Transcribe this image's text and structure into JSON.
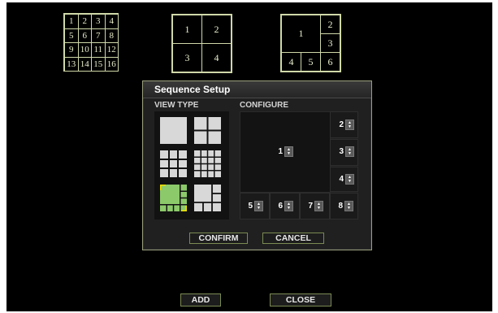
{
  "layouts": {
    "sixteen": [
      "1",
      "2",
      "3",
      "4",
      "5",
      "6",
      "7",
      "8",
      "9",
      "10",
      "11",
      "12",
      "13",
      "14",
      "15",
      "16"
    ],
    "four": [
      "1",
      "2",
      "3",
      "4"
    ],
    "six": [
      "1",
      "2",
      "3",
      "4",
      "5",
      "6"
    ]
  },
  "dialog": {
    "title": "Sequence Setup",
    "view_type_label": "VIEW TYPE",
    "configure_label": "CONFIGURE",
    "selected_view_type": "1+7 split",
    "channels": [
      {
        "slot": "1",
        "value": "1"
      },
      {
        "slot": "2",
        "value": "2"
      },
      {
        "slot": "3",
        "value": "3"
      },
      {
        "slot": "4",
        "value": "4"
      },
      {
        "slot": "5",
        "value": "5"
      },
      {
        "slot": "6",
        "value": "6"
      },
      {
        "slot": "7",
        "value": "7"
      },
      {
        "slot": "8",
        "value": "8"
      }
    ],
    "confirm_label": "CONFIRM",
    "cancel_label": "CANCEL"
  },
  "footer": {
    "add_label": "ADD",
    "close_label": "CLOSE"
  },
  "colors": {
    "accent_border": "#cfd8a8",
    "selected_view": "#8cc96a",
    "selection_corner": "#f0e000"
  }
}
